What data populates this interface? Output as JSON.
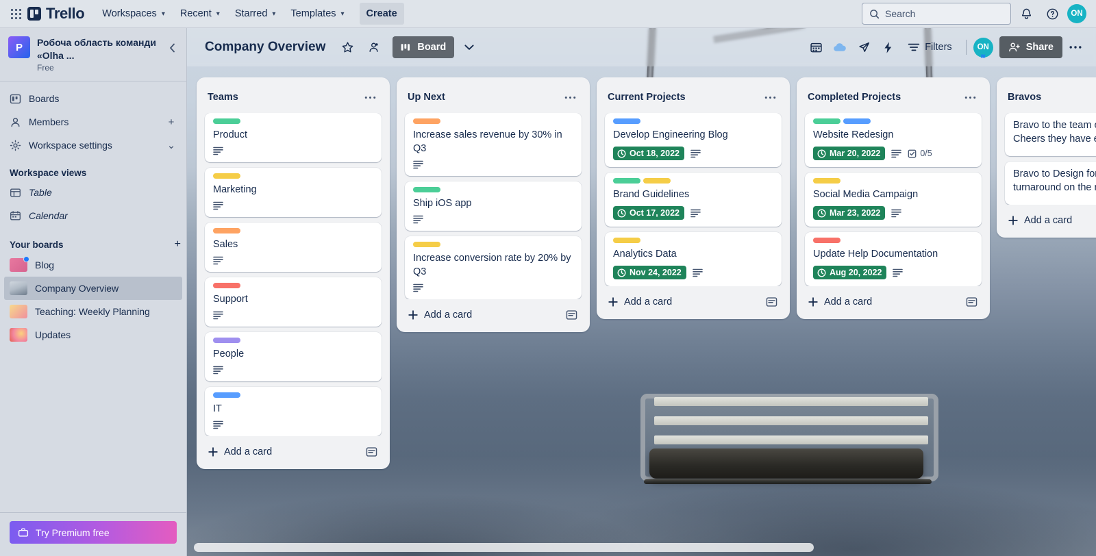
{
  "top_nav": {
    "apps_icon": "grid-apps-icon",
    "brand": "Trello",
    "items": [
      {
        "label": "Workspaces",
        "has_chevron": true
      },
      {
        "label": "Recent",
        "has_chevron": true
      },
      {
        "label": "Starred",
        "has_chevron": true
      },
      {
        "label": "Templates",
        "has_chevron": true
      }
    ],
    "create_label": "Create",
    "search_placeholder": "Search",
    "notifications_icon": "bell-icon",
    "help_icon": "help-circle-icon",
    "avatar_initials": "ON"
  },
  "sidebar": {
    "workspace": {
      "logo_initial": "P",
      "name": "Робоча область команди «Olha ...",
      "plan": "Free",
      "collapse_icon": "chevron-left-icon"
    },
    "nav": [
      {
        "label": "Boards",
        "icon": "board-icon",
        "trailing": ""
      },
      {
        "label": "Members",
        "icon": "person-icon",
        "trailing": "+"
      },
      {
        "label": "Workspace settings",
        "icon": "gear-icon",
        "trailing": "⌄"
      }
    ],
    "views_title": "Workspace views",
    "views": [
      {
        "label": "Table",
        "icon": "table-icon"
      },
      {
        "label": "Calendar",
        "icon": "calendar-icon"
      }
    ],
    "boards_title": "Your boards",
    "boards_add": "+",
    "boards": [
      {
        "label": "Blog",
        "thumb_colors": [
          "#e8789f",
          "#d6638f"
        ],
        "badge": true,
        "active": false
      },
      {
        "label": "Company Overview",
        "thumb_colors": [
          "#c9d2dc",
          "#7d8a99"
        ],
        "badge": false,
        "active": true
      },
      {
        "label": "Teaching: Weekly Planning",
        "thumb_colors": [
          "#f6d98a",
          "#f08f9c"
        ],
        "badge": false,
        "active": false
      },
      {
        "label": "Updates",
        "thumb_colors": [
          "#f3a0b4",
          "#e8664f"
        ],
        "badge": false,
        "active": false
      }
    ],
    "premium_label": "Try Premium free",
    "premium_icon": "briefcase-icon"
  },
  "board_header": {
    "title": "Company Overview",
    "star_icon": "star-icon",
    "visibility_icon": "workspace-visible-icon",
    "view_label": "Board",
    "view_icon": "board-view-icon",
    "view_chevron": "chevron-down-icon",
    "right_icons": [
      {
        "name": "calendar-icon"
      },
      {
        "name": "cloud-icon"
      },
      {
        "name": "rocket-icon"
      },
      {
        "name": "automation-bolt-icon"
      }
    ],
    "filters_label": "Filters",
    "filters_icon": "filter-icon",
    "member_initials": "ON",
    "share_label": "Share",
    "share_icon": "person-add-icon",
    "more_icon": "ellipsis-icon"
  },
  "label_colors": {
    "green": "#4BCE97",
    "yellow": "#F5CD47",
    "orange": "#FEA362",
    "red": "#F87168",
    "purple": "#9F8FEF",
    "blue": "#579DFF"
  },
  "accent": {
    "due_badge_bg": "#1F845A",
    "brand_navy": "#172B4D",
    "avatar_teal": "#17B3C4"
  },
  "lists": [
    {
      "title": "Teams",
      "menu_icon": "ellipsis-icon",
      "add_card_label": "Add a card",
      "template_icon": "card-template-icon",
      "cards": [
        {
          "title": "Product",
          "labels": [
            "green"
          ],
          "due": "",
          "desc": true,
          "checklist": ""
        },
        {
          "title": "Marketing",
          "labels": [
            "yellow"
          ],
          "due": "",
          "desc": true,
          "checklist": ""
        },
        {
          "title": "Sales",
          "labels": [
            "orange"
          ],
          "due": "",
          "desc": true,
          "checklist": ""
        },
        {
          "title": "Support",
          "labels": [
            "red"
          ],
          "due": "",
          "desc": true,
          "checklist": ""
        },
        {
          "title": "People",
          "labels": [
            "purple"
          ],
          "due": "",
          "desc": true,
          "checklist": ""
        },
        {
          "title": "IT",
          "labels": [
            "blue"
          ],
          "due": "",
          "desc": true,
          "checklist": ""
        }
      ]
    },
    {
      "title": "Up Next",
      "menu_icon": "ellipsis-icon",
      "add_card_label": "Add a card",
      "template_icon": "card-template-icon",
      "cards": [
        {
          "title": "Increase sales revenue by 30% in Q3",
          "labels": [
            "orange"
          ],
          "due": "",
          "desc": true,
          "checklist": ""
        },
        {
          "title": "Ship iOS app",
          "labels": [
            "green"
          ],
          "due": "",
          "desc": true,
          "checklist": ""
        },
        {
          "title": "Increase conversion rate by 20% by Q3",
          "labels": [
            "yellow"
          ],
          "due": "",
          "desc": true,
          "checklist": ""
        }
      ]
    },
    {
      "title": "Current Projects",
      "menu_icon": "ellipsis-icon",
      "add_card_label": "Add a card",
      "template_icon": "card-template-icon",
      "cards": [
        {
          "title": "Develop Engineering Blog",
          "labels": [
            "blue"
          ],
          "due": "Oct 18, 2022",
          "desc": true,
          "checklist": ""
        },
        {
          "title": "Brand Guidelines",
          "labels": [
            "green",
            "yellow"
          ],
          "due": "Oct 17, 2022",
          "desc": true,
          "checklist": ""
        },
        {
          "title": "Analytics Data",
          "labels": [
            "yellow"
          ],
          "due": "Nov 24, 2022",
          "desc": true,
          "checklist": ""
        }
      ]
    },
    {
      "title": "Completed Projects",
      "menu_icon": "ellipsis-icon",
      "add_card_label": "Add a card",
      "template_icon": "card-template-icon",
      "cards": [
        {
          "title": "Website Redesign",
          "labels": [
            "green",
            "blue"
          ],
          "due": "Mar 20, 2022",
          "desc": true,
          "checklist": "0/5"
        },
        {
          "title": "Social Media Campaign",
          "labels": [
            "yellow"
          ],
          "due": "Mar 23, 2022",
          "desc": true,
          "checklist": ""
        },
        {
          "title": "Update Help Documentation",
          "labels": [
            "red"
          ],
          "due": "Aug 20, 2022",
          "desc": true,
          "checklist": ""
        }
      ]
    },
    {
      "title": "Bravos",
      "menu_icon": "ellipsis-icon",
      "add_card_label": "Add a card",
      "template_icon": "card-template-icon",
      "cards": [
        {
          "title": "Bravo to the team on the most Cheers they have ever received!",
          "labels": [],
          "due": "",
          "desc": false,
          "checklist": ""
        },
        {
          "title": "Bravo to Design for a quick and fine turnaround on the new designs",
          "labels": [],
          "due": "",
          "desc": false,
          "checklist": ""
        }
      ]
    }
  ]
}
